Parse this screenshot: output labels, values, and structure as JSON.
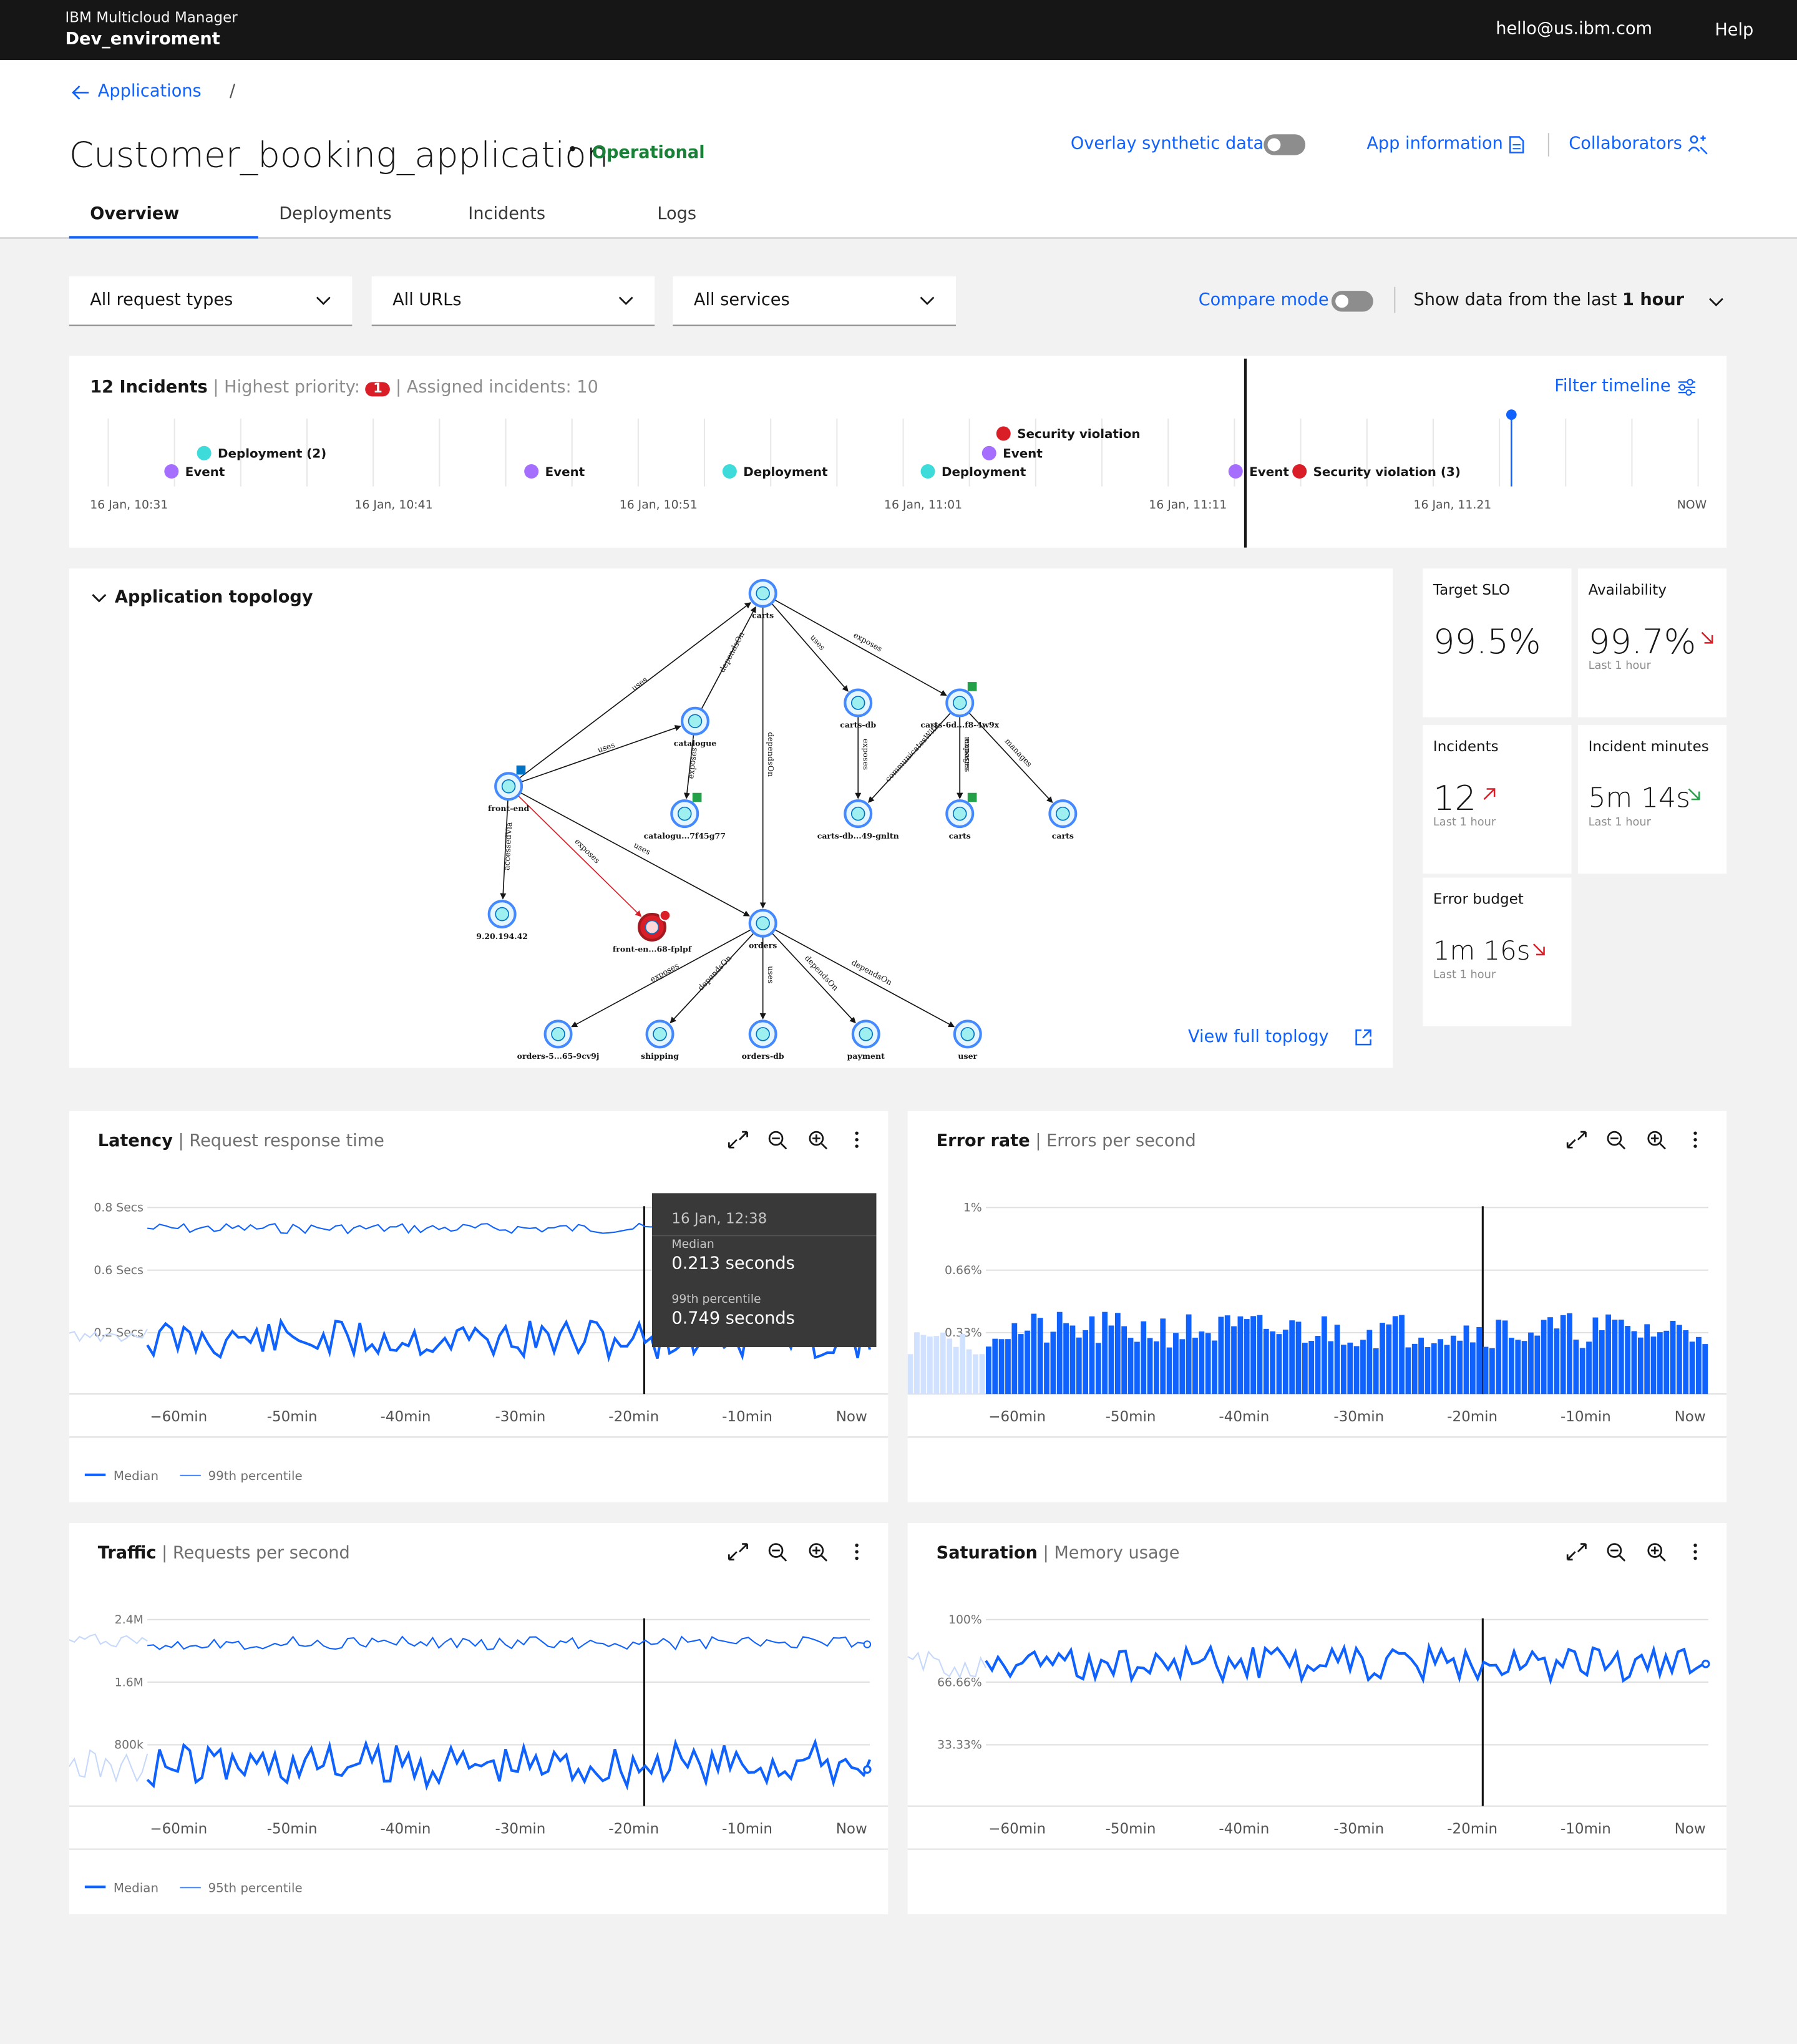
{
  "header": {
    "product": "IBM Multicloud Manager",
    "env": "Dev_enviroment",
    "email": "hello@us.ibm.com",
    "help": "Help"
  },
  "breadcrumb": {
    "back": "Applications",
    "sep": "/"
  },
  "app": {
    "name": "Customer_booking_application",
    "status": "Operational",
    "status_color": "#198038"
  },
  "actions": {
    "overlay": "Overlay synthetic data",
    "info": "App information",
    "collab": "Collaborators"
  },
  "tabs": [
    "Overview",
    "Deployments",
    "Incidents",
    "Logs"
  ],
  "filters": {
    "request_types": "All request types",
    "urls": "All URLs",
    "services": "All services",
    "compare": "Compare mode",
    "show_label": "Show data from the last",
    "show_value": "1 hour"
  },
  "incidents": {
    "count": "12 Incidents",
    "highest_label": "| Highest priority:",
    "highest_value": "1",
    "assigned": "| Assigned incidents: 10",
    "filter": "Filter timeline",
    "ticks": [
      "16 Jan, 10:31",
      "16 Jan, 10:41",
      "16 Jan, 10:51",
      "16 Jan, 11:01",
      "16 Jan, 11:11",
      "16 Jan, 11.21",
      "NOW"
    ],
    "events": [
      {
        "label": "Deployment (2)",
        "color": "#3ddbd9"
      },
      {
        "label": "Event",
        "color": "#a56eff"
      },
      {
        "label": "Event",
        "color": "#a56eff"
      },
      {
        "label": "Deployment",
        "color": "#3ddbd9"
      },
      {
        "label": "Security violation",
        "color": "#da1e28"
      },
      {
        "label": "Event",
        "color": "#a56eff"
      },
      {
        "label": "Deployment",
        "color": "#3ddbd9"
      },
      {
        "label": "Event",
        "color": "#a56eff"
      },
      {
        "label": "Security violation (3)",
        "color": "#da1e28"
      }
    ]
  },
  "topology": {
    "title": "Application topology",
    "view_full": "View full toplogy",
    "nodes": [
      "carts",
      "catalogue",
      "carts-db",
      "carts-6d...f8-4w9x",
      "front-end",
      "catalogu...7f45g77",
      "carts-db...49-gnltn",
      "carts",
      "carts",
      "9.20.194.42",
      "front-en...68-fplpf",
      "orders",
      "orders-5...65-9cv9j",
      "shipping",
      "orders-db",
      "payment",
      "user"
    ],
    "edges": [
      "uses",
      "dependsOn",
      "uses",
      "exposes",
      "uses",
      "exposes",
      "exposes",
      "dependsOn",
      "exposes",
      "communicatesWith",
      "manages",
      "manages",
      "accessedVia",
      "exposes",
      "uses",
      "exposes",
      "dependsOn",
      "uses",
      "dependsOn",
      "dependsOn"
    ]
  },
  "kpis": [
    {
      "title": "Target SLO",
      "value": "99.5%",
      "sub": ""
    },
    {
      "title": "Availability",
      "value": "99.7%",
      "sub": "Last 1 hour"
    },
    {
      "title": "Incidents",
      "value": "12",
      "sub": "Last 1 hour"
    },
    {
      "title": "Incident minutes",
      "value": "5m 14s",
      "sub": "Last 1 hour"
    },
    {
      "title": "Error budget",
      "value": "1m 16s",
      "sub": "Last 1 hour"
    }
  ],
  "chart_data": [
    {
      "type": "line",
      "title": "Latency",
      "subtitle": "| Request response time",
      "x": [
        "−60min",
        "-50min",
        "-40min",
        "-30min",
        "-20min",
        "-10min",
        "Now"
      ],
      "yticks": [
        "0.8 Secs",
        "0.6 Secs",
        "0.2 Secs"
      ],
      "legend": [
        "Median",
        "99th percentile"
      ],
      "tooltip": {
        "time": "16 Jan, 12:38",
        "l1": "Median",
        "v1": "0.213 seconds",
        "l2": "99th percentile",
        "v2": "0.749 seconds"
      }
    },
    {
      "type": "bar",
      "title": "Error rate",
      "subtitle": "| Errors per second",
      "x": [
        "−60min",
        "-50min",
        "-40min",
        "-30min",
        "-20min",
        "-10min",
        "Now"
      ],
      "yticks": [
        "1%",
        "0.66%",
        "0.33%"
      ]
    },
    {
      "type": "line",
      "title": "Traffic",
      "subtitle": "| Requests per second",
      "x": [
        "−60min",
        "-50min",
        "-40min",
        "-30min",
        "-20min",
        "-10min",
        "Now"
      ],
      "yticks": [
        "2.4M",
        "1.6M",
        "800k"
      ],
      "legend": [
        "Median",
        "95th percentile"
      ]
    },
    {
      "type": "line",
      "title": "Saturation",
      "subtitle": "| Memory usage",
      "x": [
        "−60min",
        "-50min",
        "-40min",
        "-30min",
        "-20min",
        "-10min",
        "Now"
      ],
      "yticks": [
        "100%",
        "66.66%",
        "33.33%"
      ]
    }
  ]
}
